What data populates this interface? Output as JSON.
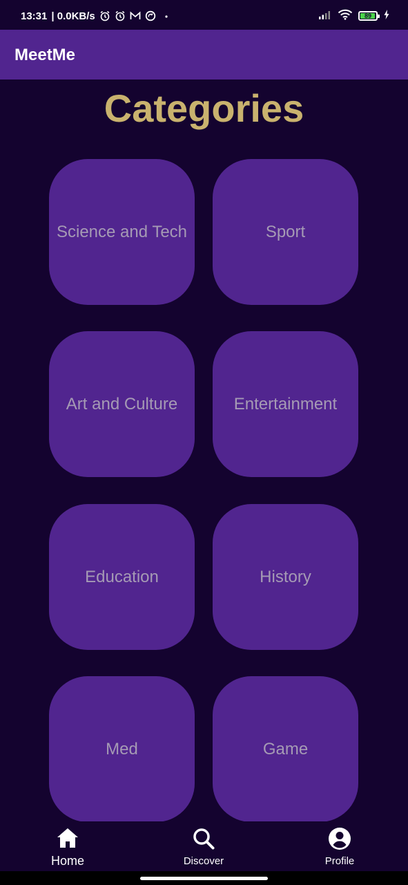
{
  "status_bar": {
    "time": "13:31",
    "network_speed": "| 0.0KB/s",
    "battery_level": "89",
    "icons": [
      "alarm-icon",
      "alarm-icon",
      "gmail-icon",
      "sync-icon",
      "dot-icon",
      "signal-icon",
      "wifi-icon",
      "battery-icon",
      "charging-icon"
    ]
  },
  "app_bar": {
    "title": "MeetMe"
  },
  "page": {
    "title": "Categories"
  },
  "categories": [
    "Science and Tech",
    "Sport",
    "Art and Culture",
    "Entertainment",
    "Education",
    "History",
    "Med",
    "Game"
  ],
  "bottom_nav": {
    "items": [
      {
        "label": "Home",
        "icon": "home-icon",
        "active": true
      },
      {
        "label": "Discover",
        "icon": "search-icon",
        "active": false
      },
      {
        "label": "Profile",
        "icon": "account-circle-icon",
        "active": false
      }
    ]
  },
  "colors": {
    "background": "#14032f",
    "primary": "#51258f",
    "title_gold": "#c9b26e",
    "card_text": "#a59ab4",
    "battery_green": "#4ad24a"
  }
}
